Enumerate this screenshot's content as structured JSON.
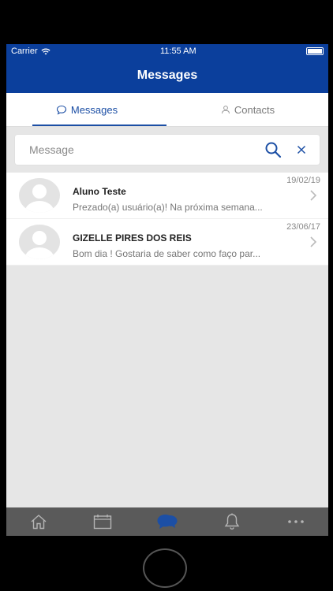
{
  "status_bar": {
    "carrier": "Carrier",
    "time": "11:55 AM"
  },
  "header": {
    "title": "Messages"
  },
  "tabs": [
    {
      "label": "Messages",
      "icon": "chat-bubble-icon",
      "active": true
    },
    {
      "label": "Contacts",
      "icon": "person-icon",
      "active": false
    }
  ],
  "search": {
    "placeholder": "Message",
    "value": ""
  },
  "messages": [
    {
      "name": "Aluno Teste",
      "preview": "Prezado(a) usuário(a)! Na próxima semana...",
      "date": "19/02/19"
    },
    {
      "name": "GIZELLE PIRES DOS REIS",
      "preview": "Bom dia ! Gostaria de saber como faço par...",
      "date": "23/06/17"
    }
  ],
  "bottom_nav": [
    {
      "icon": "home-icon",
      "active": false
    },
    {
      "icon": "calendar-icon",
      "active": false
    },
    {
      "icon": "chat-bubbles-icon",
      "active": true
    },
    {
      "icon": "bell-icon",
      "active": false
    },
    {
      "icon": "more-dots-icon",
      "active": false
    }
  ],
  "colors": {
    "brand": "#0b3f9c",
    "accent": "#1c4fa5",
    "background": "#e6e6e6",
    "bottom_bar": "#5a5a5a"
  }
}
